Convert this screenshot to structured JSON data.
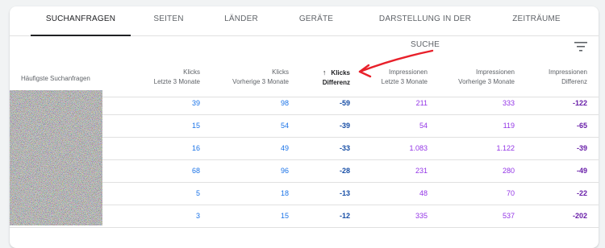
{
  "tabs": [
    {
      "label": "SUCHANFRAGEN",
      "active": true
    },
    {
      "label": "SEITEN"
    },
    {
      "label": "LÄNDER"
    },
    {
      "label": "GERÄTE"
    },
    {
      "label": "DARSTELLUNG IN DER SUCHE"
    },
    {
      "label": "ZEITRÄUME"
    }
  ],
  "filter_icon": "filter-list-icon",
  "table": {
    "query_header": "Häufigste Suchanfragen",
    "columns": [
      {
        "line1": "Klicks",
        "line2": "Letzte 3 Monate"
      },
      {
        "line1": "Klicks",
        "line2": "Vorherige 3 Monate"
      },
      {
        "line1": "Klicks",
        "line2": "Differenz",
        "sorted": true,
        "sort_icon": "arrow-upward-icon"
      },
      {
        "line1": "Impressionen",
        "line2": "Letzte 3 Monate"
      },
      {
        "line1": "Impressionen",
        "line2": "Vorherige 3 Monate"
      },
      {
        "line1": "Impressionen",
        "line2": "Differenz"
      }
    ],
    "rows": [
      {
        "clicks_last": "39",
        "clicks_prev": "98",
        "clicks_diff": "-59",
        "impr_last": "211",
        "impr_prev": "333",
        "impr_diff": "-122"
      },
      {
        "clicks_last": "15",
        "clicks_prev": "54",
        "clicks_diff": "-39",
        "impr_last": "54",
        "impr_prev": "119",
        "impr_diff": "-65"
      },
      {
        "clicks_last": "16",
        "clicks_prev": "49",
        "clicks_diff": "-33",
        "impr_last": "1.083",
        "impr_prev": "1.122",
        "impr_diff": "-39"
      },
      {
        "clicks_last": "68",
        "clicks_prev": "96",
        "clicks_diff": "-28",
        "impr_last": "231",
        "impr_prev": "280",
        "impr_diff": "-49"
      },
      {
        "clicks_last": "5",
        "clicks_prev": "18",
        "clicks_diff": "-13",
        "impr_last": "48",
        "impr_prev": "70",
        "impr_diff": "-22"
      },
      {
        "clicks_last": "3",
        "clicks_prev": "15",
        "clicks_diff": "-12",
        "impr_last": "335",
        "impr_prev": "537",
        "impr_diff": "-202"
      }
    ]
  },
  "colors": {
    "clicks": "#1a73e8",
    "impressions": "#9334e6",
    "annotation": "#e8202a"
  }
}
